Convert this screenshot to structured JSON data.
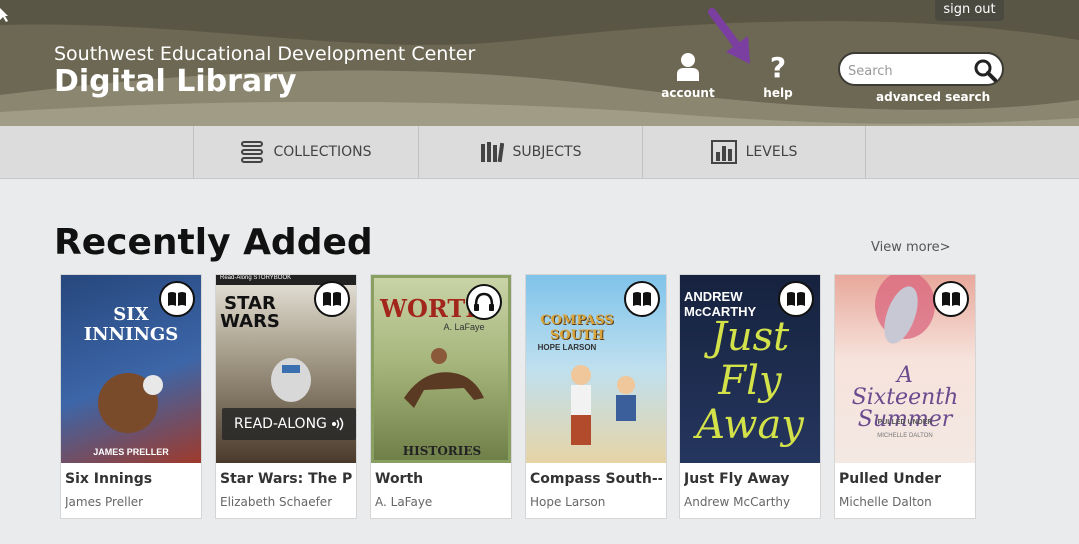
{
  "header": {
    "subtitle": "Southwest Educational Development Center",
    "title": "Digital Library",
    "signout_label": "sign out",
    "account_label": "account",
    "help_label": "help",
    "search_placeholder": "Search",
    "advanced_search_label": "advanced search"
  },
  "nav": {
    "items": [
      {
        "label": "COLLECTIONS",
        "icon": "stack-icon"
      },
      {
        "label": "SUBJECTS",
        "icon": "books-icon"
      },
      {
        "label": "LEVELS",
        "icon": "bar-levels-icon"
      }
    ]
  },
  "section": {
    "title": "Recently Added",
    "view_more": "View more>"
  },
  "books": [
    {
      "title": "Six Innings",
      "author": "James Preller",
      "badge": "book-icon",
      "cover_text": "SIX INNINGS",
      "cover_author": "JAMES PRELLER",
      "cover_color": "#2d4f86"
    },
    {
      "title": "Star Wars: The Phantom Menace",
      "author": "Elizabeth Schaefer",
      "badge": "book-icon",
      "cover_text": "STAR WARS",
      "cover_sub": "Read-Along STORYBOOK",
      "readalong": "READ-ALONG",
      "cover_color": "#3a3026"
    },
    {
      "title": "Worth",
      "author": "A. LaFaye",
      "badge": "headphones-icon",
      "cover_text": "WORTH",
      "cover_sub": "A. LaFaye",
      "cover_bottom": "HISTORIES",
      "cover_color": "#8aa063"
    },
    {
      "title": "Compass South--A Graphic Novel",
      "author": "Hope Larson",
      "badge": "book-icon",
      "cover_text": "COMPASS SOUTH",
      "cover_sub": "HOPE LARSON",
      "cover_color": "#6fb7e0"
    },
    {
      "title": "Just Fly Away",
      "author": "Andrew McCarthy",
      "badge": "book-icon",
      "cover_text": "Just Fly Away",
      "cover_sub": "ANDREW McCARTHY",
      "cover_color": "#1d2a48"
    },
    {
      "title": "Pulled Under",
      "author": "Michelle Dalton",
      "badge": "book-icon",
      "cover_text": "A Sixteenth Summer",
      "cover_sub": "PULLED UNDER",
      "cover_bottom": "MICHELLE DALTON",
      "cover_color": "#f4dfd6"
    }
  ],
  "colors": {
    "header_bg": "#6d6853",
    "annotation_arrow": "#7b3fa2",
    "nav_bg": "#dcdcdc",
    "page_bg": "#e9ebec"
  }
}
